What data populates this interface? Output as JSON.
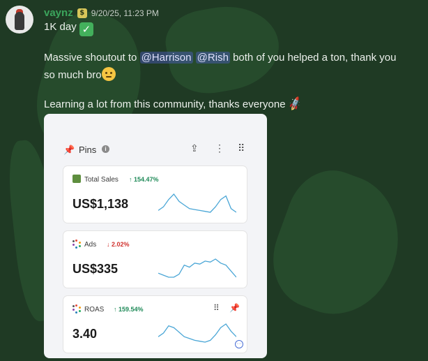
{
  "message": {
    "username": "vaynz",
    "role_badge": "$",
    "timestamp": "9/20/25, 11:23 PM",
    "line1": "1K day",
    "line2_prefix": "Massive shoutout to",
    "mention1": "@Harrison",
    "mention2": "@Rish",
    "line2_suffix": "both of you helped a ton, thank you",
    "line3": "so much bro",
    "line4": "Learning a lot from this community, thanks everyone"
  },
  "screenshot": {
    "pins_title": "Pins",
    "cards": [
      {
        "label": "Total Sales",
        "change": "↑ 154.47%",
        "change_dir": "up",
        "value": "US$1,138",
        "icon": "shopify-bag-icon",
        "spark": [
          10,
          14,
          22,
          28,
          20,
          16,
          12,
          11,
          10,
          9,
          8,
          14,
          22,
          26,
          12,
          8
        ]
      },
      {
        "label": "Ads",
        "change": "↓ 2.02%",
        "change_dir": "down",
        "value": "US$335",
        "icon": "ads-dots-icon",
        "spark": [
          10,
          8,
          6,
          6,
          9,
          18,
          16,
          20,
          19,
          22,
          21,
          24,
          20,
          18,
          12,
          6
        ]
      },
      {
        "label": "ROAS",
        "change": "↑ 159.54%",
        "change_dir": "up",
        "value": "3.40",
        "icon": "roas-dots-icon",
        "spark": [
          12,
          16,
          24,
          22,
          17,
          12,
          10,
          8,
          7,
          6,
          8,
          14,
          22,
          26,
          18,
          12
        ]
      }
    ]
  },
  "colors": {
    "username": "#3ba55c",
    "up": "#1f8a58",
    "down": "#d0312d",
    "spark": "#4aa6d6"
  }
}
